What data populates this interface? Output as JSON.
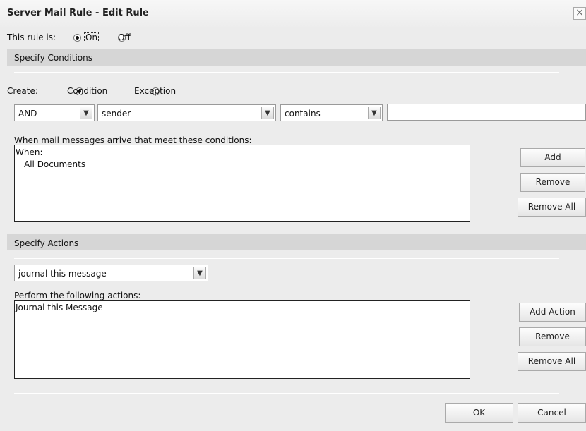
{
  "window": {
    "title": "Server Mail Rule - Edit Rule",
    "close_glyph": "×"
  },
  "status": {
    "label": "This rule is:",
    "on": "On",
    "off": "Off",
    "selected": "On"
  },
  "conditions": {
    "section_title": "Specify Conditions",
    "create_label": "Create:",
    "create_condition": "Condition",
    "create_exception": "Exception",
    "create_selected": "Condition",
    "operator": "AND",
    "field": "sender",
    "comparison": "contains",
    "value": "",
    "list_label": "When mail messages arrive that meet these conditions:",
    "list_lines": [
      "When:",
      "All Documents"
    ],
    "buttons": {
      "add": "Add",
      "remove": "Remove",
      "remove_all": "Remove All"
    }
  },
  "actions": {
    "section_title": "Specify Actions",
    "action_select": "journal this message",
    "list_label": "Perform the following actions:",
    "list_lines": [
      "Journal this Message"
    ],
    "buttons": {
      "add_action": "Add Action",
      "remove": "Remove",
      "remove_all": "Remove All"
    }
  },
  "footer": {
    "ok": "OK",
    "cancel": "Cancel"
  },
  "icons": {
    "dropdown_arrow": "chevron-down-icon",
    "close": "close-icon"
  }
}
